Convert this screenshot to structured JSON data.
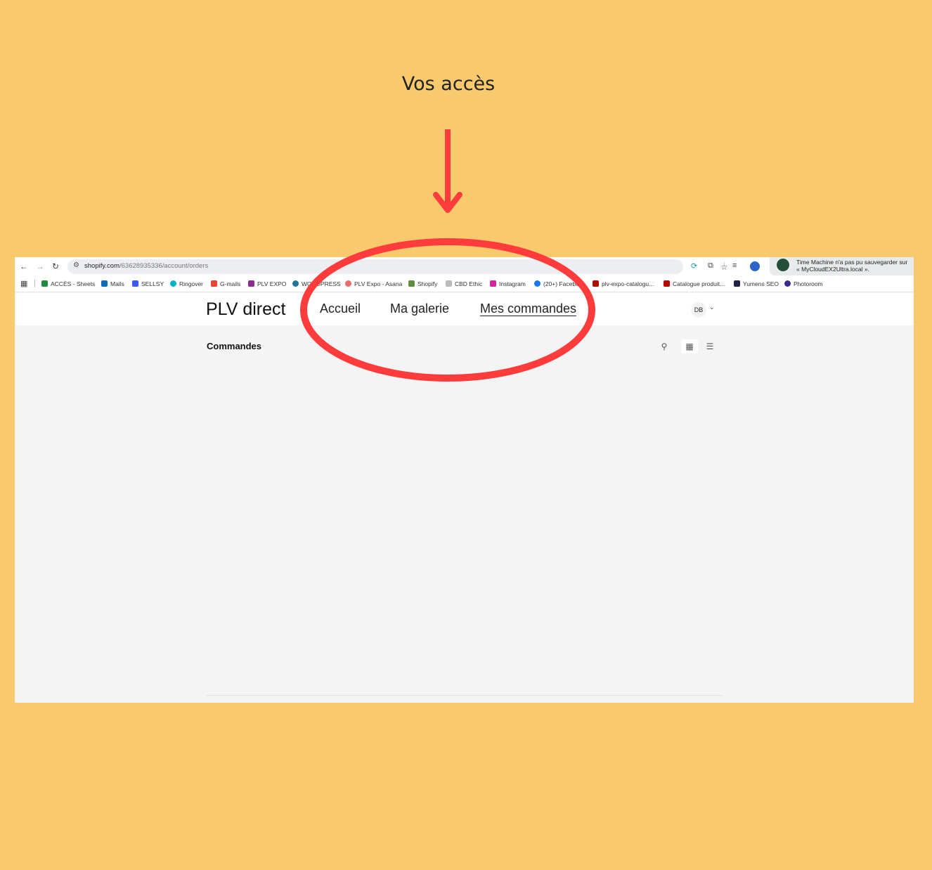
{
  "annotation": {
    "caption": "Vos accès",
    "highlight_color": "#FF3B3B"
  },
  "browser": {
    "url_host": "shopify.com",
    "url_path": "/63628935336/account/orders",
    "notification": {
      "line1": "Time Machine n'a pas pu sauvegarder sur",
      "line2": "« MyCloudEX2Ultra.local »."
    },
    "bookmarks": [
      {
        "label": "ACCÈS - Sheets",
        "color": "#1e8e3e"
      },
      {
        "label": "Mails",
        "color": "#0f6cbd"
      },
      {
        "label": "SELLSY",
        "color": "#3d5afe"
      },
      {
        "label": "Ringover",
        "color": "#00b3c7"
      },
      {
        "label": "G-mails",
        "color": "#ea4335"
      },
      {
        "label": "PLV EXPO",
        "color": "#8e2c8e"
      },
      {
        "label": "WORDPRESS",
        "color": "#21759b"
      },
      {
        "label": "PLV Expo - Asana",
        "color": "#f06a6a"
      },
      {
        "label": "Shopify",
        "color": "#5e8e3e"
      },
      {
        "label": "CBD Ethic",
        "color": "#bbbbbb"
      },
      {
        "label": "Instagram",
        "color": "#d6249f"
      },
      {
        "label": "(20+) Facebook",
        "color": "#1877f2"
      },
      {
        "label": "plv-expo-catalogu...",
        "color": "#b30b00"
      },
      {
        "label": "Catalogue produit...",
        "color": "#b30b00"
      },
      {
        "label": "Yumens SEO",
        "color": "#222244"
      },
      {
        "label": "Photoroom",
        "color": "#3b2b8e"
      }
    ]
  },
  "store": {
    "brand": "PLV direct",
    "nav": [
      {
        "label": "Accueil",
        "active": false
      },
      {
        "label": "Ma galerie",
        "active": false
      },
      {
        "label": "Mes commandes",
        "active": true
      }
    ],
    "user_initials": "DB"
  },
  "page": {
    "title": "Commandes"
  }
}
